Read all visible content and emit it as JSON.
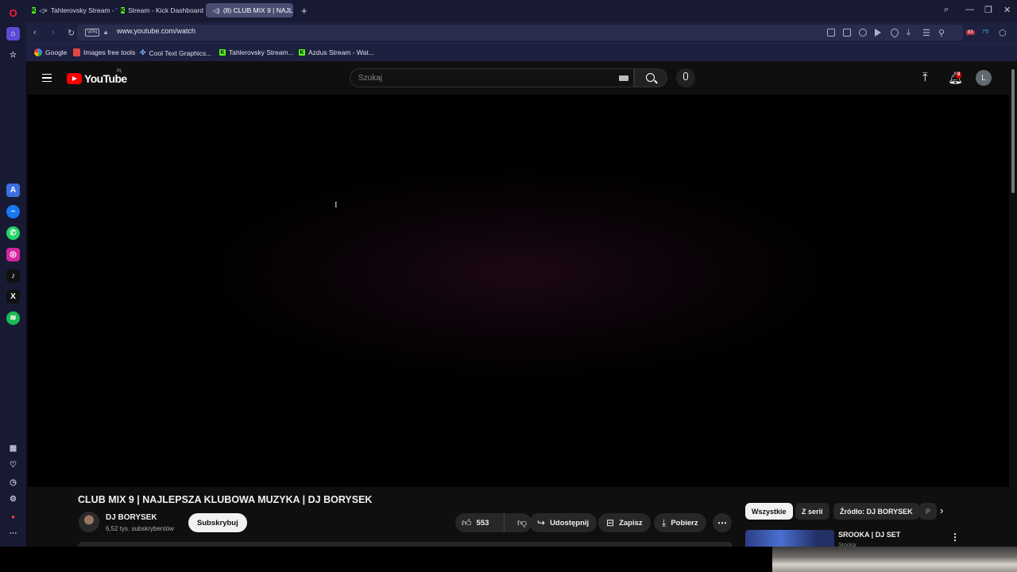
{
  "browser": {
    "tabs": [
      {
        "label": "Tahlerovsky Stream - V"
      },
      {
        "label": "Stream - Kick Dashboard"
      },
      {
        "label": "(8) CLUB MIX 9 | NAJL"
      }
    ],
    "vpn_label": "VPN",
    "url": "www.youtube.com/watch",
    "bookmarks": [
      {
        "label": "Google"
      },
      {
        "label": "Images free tools"
      },
      {
        "label": "Cool Text Graphics..."
      },
      {
        "label": "Tahlerovsky Stream..."
      },
      {
        "label": "Azdus Stream - Wat..."
      }
    ],
    "opera_logo": "O",
    "extension_badge": "83"
  },
  "youtube": {
    "logo_text": "YouTube",
    "region": "PL",
    "search_placeholder": "Szukaj",
    "notifications_count": "8",
    "avatar_letter": "L",
    "video": {
      "title": "CLUB MIX 9 | NAJLEPSZA KLUBOWA MUZYKA | DJ BORYSEK",
      "channel_name": "DJ BORYSEK",
      "subscribers": "6,52 tys. subskrybentów",
      "subscribe_label": "Subskrybuj",
      "like_count": "553",
      "share_label": "Udostępnij",
      "save_label": "Zapisz",
      "download_label": "Pobierz"
    },
    "chips": [
      {
        "label": "Wszystkie"
      },
      {
        "label": "Z serii"
      },
      {
        "label": "Źródło: DJ BORYSEK"
      },
      {
        "label": "P"
      }
    ],
    "recommendation": {
      "title": "SROOKA | DJ SET",
      "subtitle": "Srooka"
    }
  },
  "colors": {
    "browser_chrome": "#181a34",
    "youtube_bg": "#0f0f0f",
    "youtube_red": "#ff0000",
    "kick_green": "#53fc18"
  }
}
